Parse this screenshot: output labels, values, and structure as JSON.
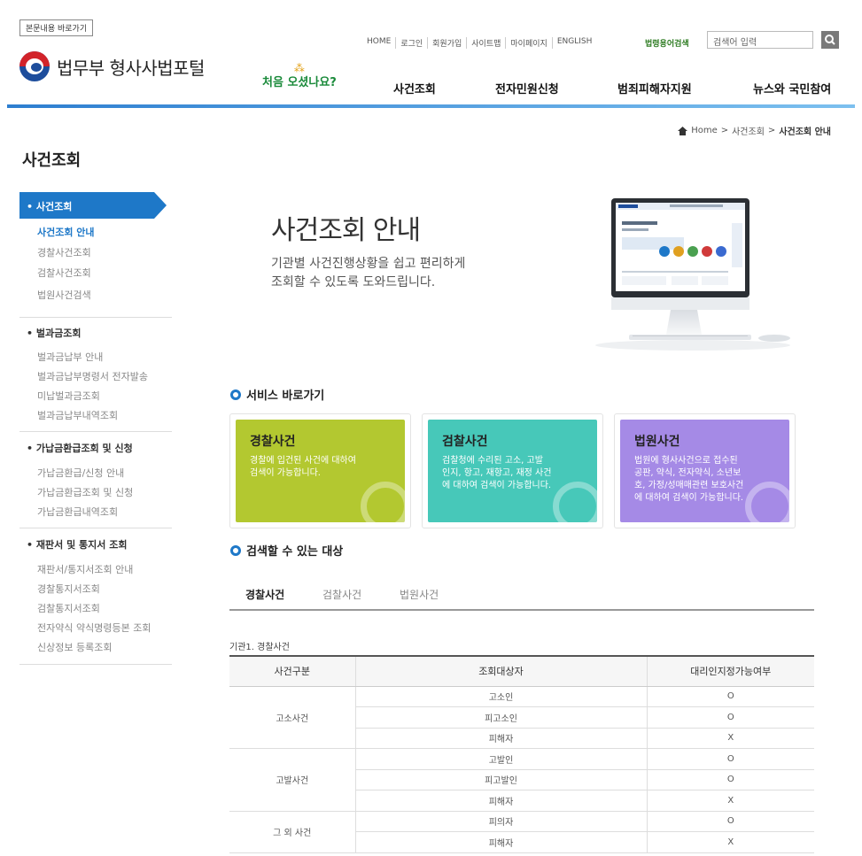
{
  "header": {
    "skip_link": "본문내용 바로가기",
    "logo_text": "법무부 형사사법포털",
    "util_links": [
      "HOME",
      "로그인",
      "회원가입",
      "사이트맵",
      "마이페이지",
      "ENGLISH"
    ],
    "law_term_search": "법령용어검색",
    "search_placeholder": "검색어 입력",
    "first_visit": "처음 오셨나요?",
    "gnb": [
      "사건조회",
      "전자민원신청",
      "범죄피해자지원",
      "뉴스와 국민참여"
    ]
  },
  "breadcrumb": {
    "home": "Home",
    "level1": "사건조회",
    "current": "사건조회 안내"
  },
  "sidebar": {
    "title": "사건조회",
    "groups": [
      {
        "label": "사건조회",
        "items": [
          "사건조회 안내",
          "경찰사건조회",
          "검찰사건조회",
          "법원사건검색"
        ]
      },
      {
        "label": "벌과금조회",
        "items": [
          "벌과금납부 안내",
          "벌과금납부명령서 전자발송",
          "미납벌과금조회",
          "벌과금납부내역조회"
        ]
      },
      {
        "label": "가납금환급조회 및 신청",
        "items": [
          "가납금환급/신청 안내",
          "가납금환급조회 및 신청",
          "가납금환급내역조회"
        ]
      },
      {
        "label": "재판서 및 통지서 조회",
        "items": [
          "재판서/통지서조회 안내",
          "경찰통지서조회",
          "검찰통지서조회",
          "전자약식 약식명령등본 조회",
          "신상정보 등록조회"
        ]
      }
    ]
  },
  "hero": {
    "title": "사건조회 안내",
    "desc_line1": "기관별 사건진행상황을 쉽고 편리하게",
    "desc_line2": "조회할 수 있도록 도와드립니다."
  },
  "services": {
    "title": "서비스 바로가기",
    "cards": [
      {
        "title": "경찰사건",
        "desc": [
          "경찰에 입건된 사건에 대하여",
          "검색이 가능합니다."
        ]
      },
      {
        "title": "검찰사건",
        "desc": [
          "검찰청에 수리된 고소, 고발",
          "인지, 항고, 재항고, 재정 사건",
          "에 대하여 검색이 가능합니다."
        ]
      },
      {
        "title": "법원사건",
        "desc": [
          "법원에 형사사건으로 접수된",
          "공판, 약식, 전자약식, 소년보",
          "호, 가정/성매매관련 보호사건",
          "에 대하여 검색이 가능합니다."
        ]
      }
    ]
  },
  "targets": {
    "title": "검색할 수 있는 대상",
    "tabs": [
      "경찰사건",
      "검찰사건",
      "법원사건"
    ],
    "caption": "기관1. 경찰사건",
    "table": {
      "headers": [
        "사건구분",
        "조회대상자",
        "대리인지정가능여부"
      ],
      "groups": [
        {
          "category": "고소사건",
          "rows": [
            [
              "고소인",
              "O"
            ],
            [
              "피고소인",
              "O"
            ],
            [
              "피해자",
              "X"
            ]
          ]
        },
        {
          "category": "고발사건",
          "rows": [
            [
              "고발인",
              "O"
            ],
            [
              "피고발인",
              "O"
            ],
            [
              "피해자",
              "X"
            ]
          ]
        },
        {
          "category": "그 외 사건",
          "rows": [
            [
              "피의자",
              "O"
            ],
            [
              "피해자",
              "X"
            ]
          ]
        }
      ]
    }
  },
  "colors": {
    "accent": "#1e78c8",
    "card1": "#b3c830",
    "card2": "#47c8b9",
    "card3": "#a58ae6",
    "first_visit": "#1a8a3a"
  },
  "icons": [
    "logo-emblem-icon",
    "search-icon",
    "home-icon",
    "ring-bullet-icon",
    "magnifier-icon",
    "monitor-illustration"
  ]
}
